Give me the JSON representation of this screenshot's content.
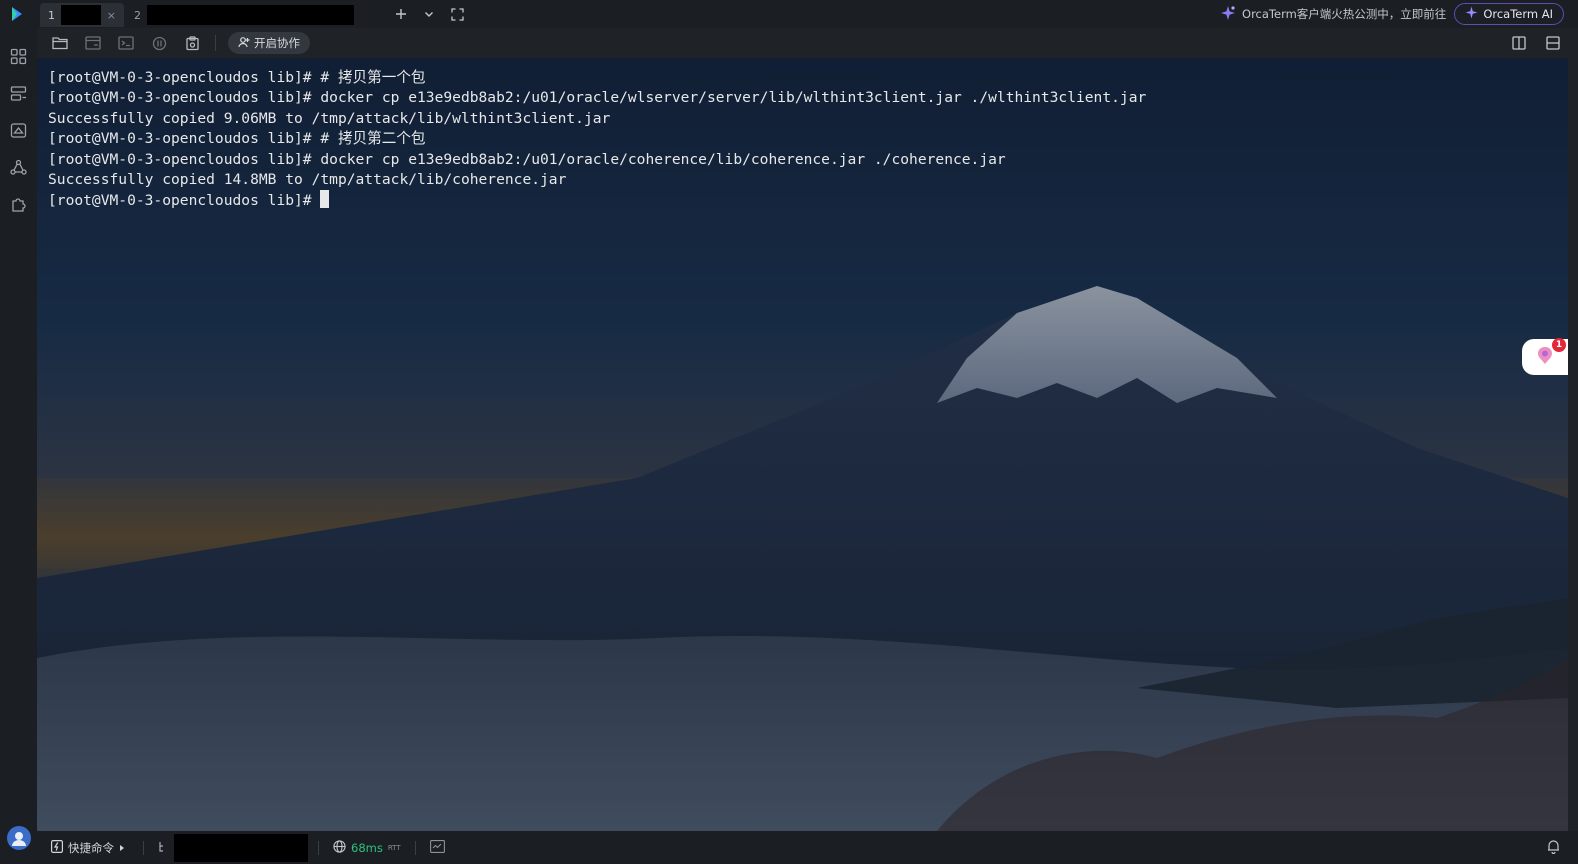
{
  "app": {
    "accent": "#3a8bff",
    "logo_icon": "orcaterm-logo-icon"
  },
  "tabs": [
    {
      "number": "1",
      "close_glyph": "×",
      "active": true
    },
    {
      "number": "2",
      "active": false
    }
  ],
  "tab_actions": {
    "add_icon": "plus-icon",
    "dropdown_icon": "chevron-down-icon",
    "fullscreen_icon": "fullscreen-icon"
  },
  "promo": {
    "text": "OrcaTerm客户端火热公测中，立即前往",
    "icon": "sparkle-icon"
  },
  "ai_button": {
    "label": "OrcaTerm AI",
    "border_color": "#5b4fb0"
  },
  "toolbar": {
    "collab_label": "开启协作",
    "icons": [
      "folder-icon",
      "sync-icon",
      "terminal-icon",
      "record-icon",
      "clipboard-icon"
    ],
    "right_icons": [
      "split-vertical-icon",
      "split-horizontal-icon"
    ]
  },
  "sidebar": {
    "icons": [
      "dashboard-icon",
      "server-list-icon",
      "instances-icon",
      "network-icon",
      "extensions-icon"
    ]
  },
  "terminal": {
    "prompt": "[root@VM-0-3-opencloudos lib]#",
    "lines": [
      "[root@VM-0-3-opencloudos lib]# # 拷贝第一个包",
      "[root@VM-0-3-opencloudos lib]# docker cp e13e9edb8ab2:/u01/oracle/wlserver/server/lib/wlthint3client.jar ./wlthint3client.jar",
      "Successfully copied 9.06MB to /tmp/attack/lib/wlthint3client.jar",
      "[root@VM-0-3-opencloudos lib]# # 拷贝第二个包",
      "[root@VM-0-3-opencloudos lib]# docker cp e13e9edb8ab2:/u01/oracle/coherence/lib/coherence.jar ./coherence.jar",
      "Successfully copied 14.8MB to /tmp/attack/lib/coherence.jar",
      "[root@VM-0-3-opencloudos lib]# "
    ]
  },
  "float_widget": {
    "badge_count": "1",
    "icon": "assistant-icon"
  },
  "statusbar": {
    "quick_cmd_label": "快捷命令",
    "latency": "68ms",
    "latency_unit": "RTT",
    "latency_color": "#2fc27a"
  }
}
